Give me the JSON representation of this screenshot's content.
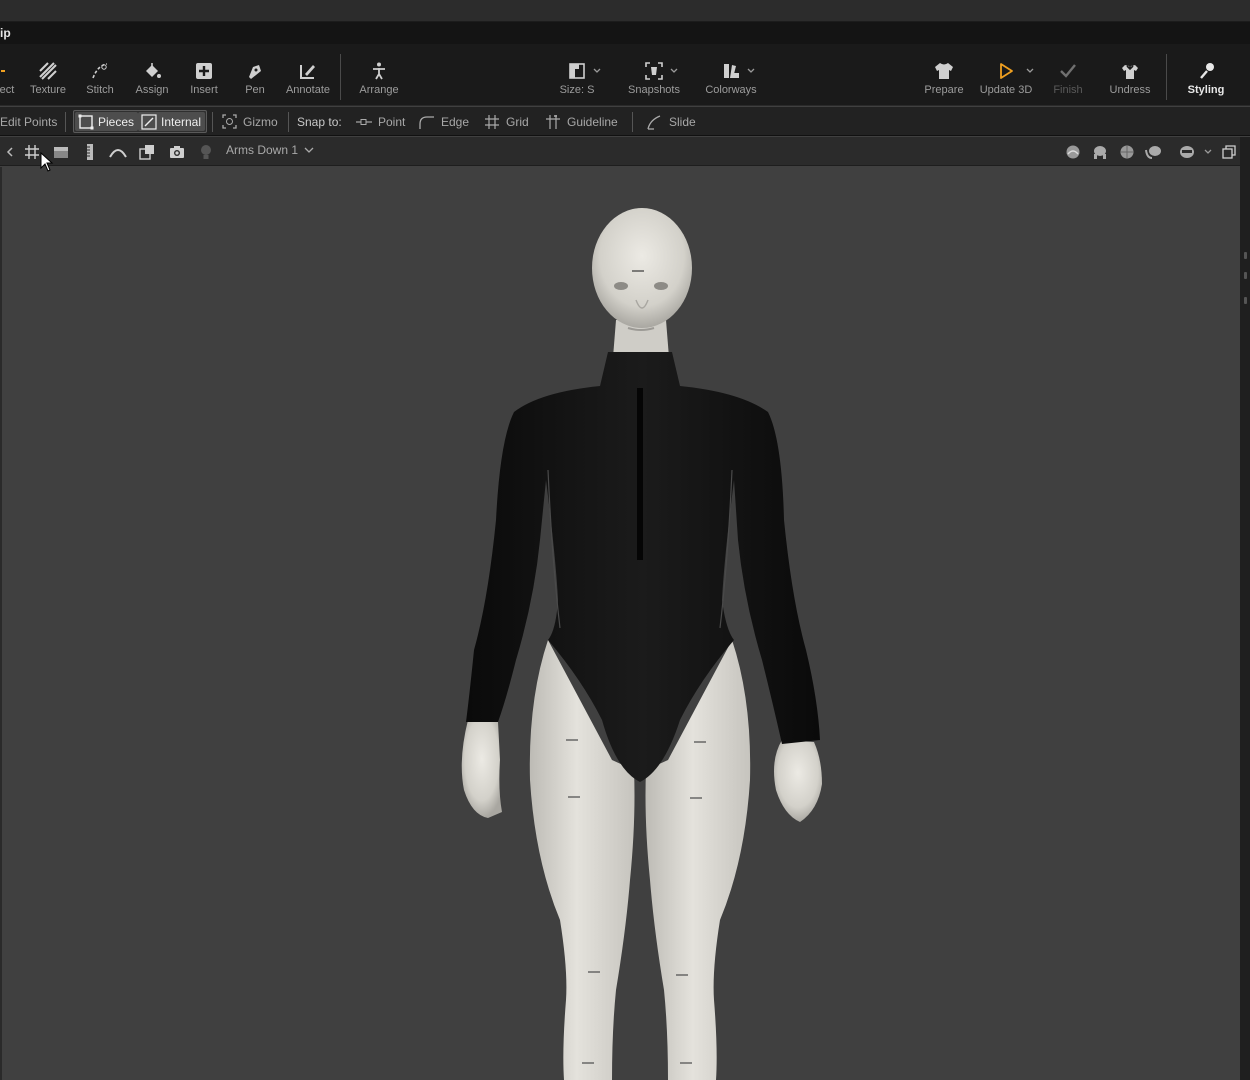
{
  "title_fragment": "",
  "menu_fragment": "ip",
  "toolbar": {
    "tools": [
      {
        "id": "select",
        "label": "ect",
        "icon": "select-icon"
      },
      {
        "id": "texture",
        "label": "Texture",
        "icon": "texture-icon"
      },
      {
        "id": "stitch",
        "label": "Stitch",
        "icon": "stitch-icon"
      },
      {
        "id": "assign",
        "label": "Assign",
        "icon": "paint-bucket-icon"
      },
      {
        "id": "insert",
        "label": "Insert",
        "icon": "plus-box-icon"
      },
      {
        "id": "pen",
        "label": "Pen",
        "icon": "pen-icon"
      },
      {
        "id": "annotate",
        "label": "Annotate",
        "icon": "annotate-icon"
      },
      {
        "id": "arrange",
        "label": "Arrange",
        "icon": "arrange-icon"
      },
      {
        "id": "size",
        "label": "Size: S",
        "icon": "size-icon"
      },
      {
        "id": "snapshots",
        "label": "Snapshots",
        "icon": "snapshot-icon"
      },
      {
        "id": "colorways",
        "label": "Colorways",
        "icon": "colorways-icon"
      },
      {
        "id": "prepare",
        "label": "Prepare",
        "icon": "shirt-icon"
      },
      {
        "id": "update3d",
        "label": "Update 3D",
        "icon": "play-icon"
      },
      {
        "id": "finish",
        "label": "Finish",
        "icon": "check-icon"
      },
      {
        "id": "undress",
        "label": "Undress",
        "icon": "undress-icon"
      },
      {
        "id": "styling",
        "label": "Styling",
        "icon": "wand-icon"
      }
    ],
    "accent": "#f0a020"
  },
  "subbar": {
    "edit_points": "Edit Points",
    "pieces": "Pieces",
    "internal": "Internal",
    "gizmo": "Gizmo",
    "snap_to": "Snap to:",
    "point": "Point",
    "edge": "Edge",
    "grid": "Grid",
    "guideline": "Guideline",
    "slide": "Slide"
  },
  "viewport_toolbar": {
    "pose": "Arms Down 1",
    "left_icons": [
      "back-icon",
      "grid-icon",
      "floor-icon",
      "ruler-icon",
      "arc-icon",
      "window-icon",
      "camera-icon",
      "light-icon"
    ],
    "right_icons": [
      "render-sphere-icon",
      "avatar-head-icon",
      "globe-icon",
      "garment-head-icon",
      "mask-head-icon",
      "restore-window-icon"
    ]
  },
  "colors": {
    "bg": "#404040",
    "garment": "#111111",
    "skin": "#d9d7d1"
  }
}
